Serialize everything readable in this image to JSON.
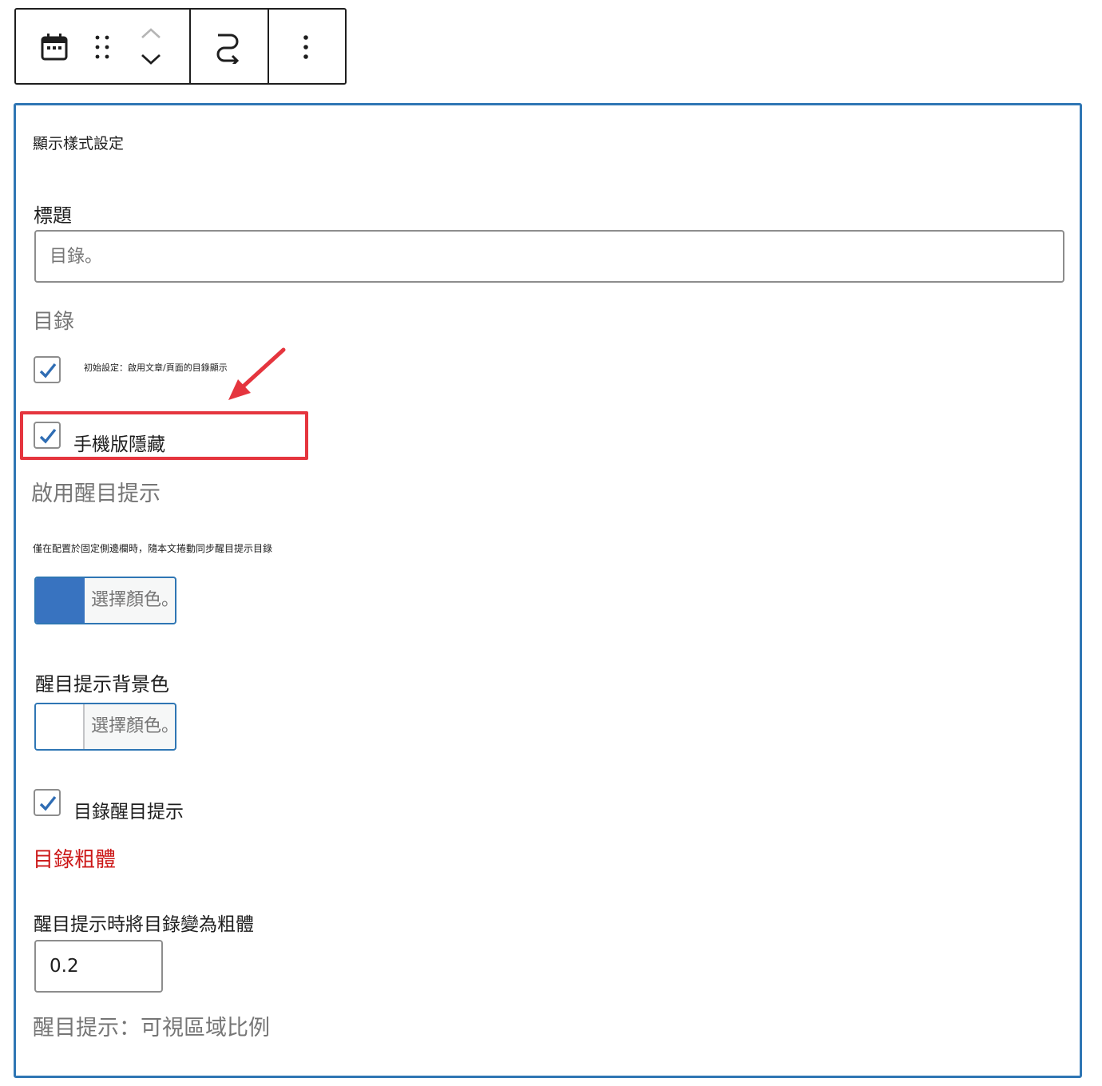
{
  "toolbar": {
    "block_icon": "calendar-icon",
    "drag_icon": "drag-handle-icon",
    "move_up_icon": "chevron-up-icon",
    "move_down_icon": "chevron-down-icon",
    "transform_icon": "redirect-arrow-icon",
    "options_icon": "more-vertical-icon"
  },
  "panel": {
    "title": "顯示樣式設定",
    "title_field": {
      "label": "標題",
      "placeholder": "目錄。"
    },
    "toc_section": {
      "heading": "目錄",
      "default_option": {
        "checked": true,
        "label": "初始設定：啟用文章/頁面的目錄顯示"
      },
      "mobile_hide_option": {
        "checked": true,
        "label": "手機版隱藏"
      }
    },
    "highlight_section": {
      "heading": "啟用醒目提示",
      "hint": "僅在配置於固定側邊欄時，隨本文捲動同步醒目提示目錄",
      "color_picker": {
        "label": "選擇顏色。",
        "color": "#3873c0"
      },
      "bg_color_label": "醒目提示背景色",
      "bg_color_picker": {
        "label": "選擇顏色。",
        "color": "#ffffff"
      },
      "toc_highlight_option": {
        "checked": true,
        "label": "目錄醒目提示"
      }
    },
    "bold_section": {
      "heading": "目錄粗體",
      "field_label": "醒目提示時將目錄變為粗體",
      "value": "0.2",
      "help": "醒目提示：可視區域比例"
    }
  },
  "colors": {
    "panel_border": "#2f76b4",
    "accent_blue": "#3873c0",
    "warning_red": "#cc1818",
    "annotation_red": "#e5353e",
    "muted_text": "#757575"
  }
}
